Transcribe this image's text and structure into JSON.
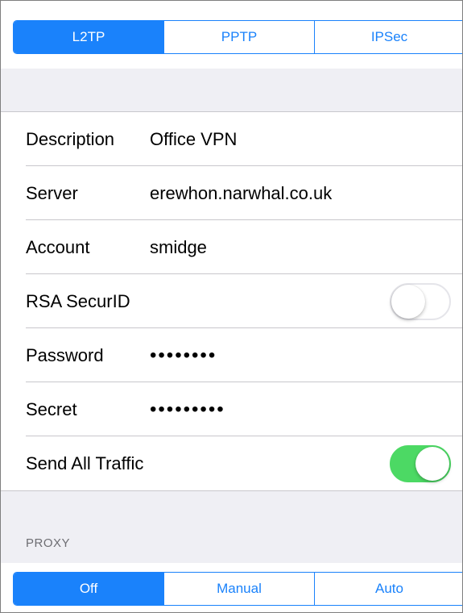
{
  "vpn_type_tabs": [
    {
      "label": "L2TP",
      "selected": true
    },
    {
      "label": "PPTP",
      "selected": false
    },
    {
      "label": "IPSec",
      "selected": false
    }
  ],
  "settings": {
    "description": {
      "label": "Description",
      "value": "Office VPN"
    },
    "server": {
      "label": "Server",
      "value": "erewhon.narwhal.co.uk"
    },
    "account": {
      "label": "Account",
      "value": "smidge"
    },
    "rsa_securid": {
      "label": "RSA SecurID",
      "enabled": false
    },
    "password": {
      "label": "Password",
      "value": "••••••••"
    },
    "secret": {
      "label": "Secret",
      "value": "•••••••••"
    },
    "send_all_traffic": {
      "label": "Send All Traffic",
      "enabled": true
    }
  },
  "proxy": {
    "header": "PROXY",
    "tabs": [
      {
        "label": "Off",
        "selected": true
      },
      {
        "label": "Manual",
        "selected": false
      },
      {
        "label": "Auto",
        "selected": false
      }
    ]
  },
  "colors": {
    "accent": "#1a82fb",
    "toggle_on": "#4cd964",
    "grouped_background": "#efeff4"
  }
}
